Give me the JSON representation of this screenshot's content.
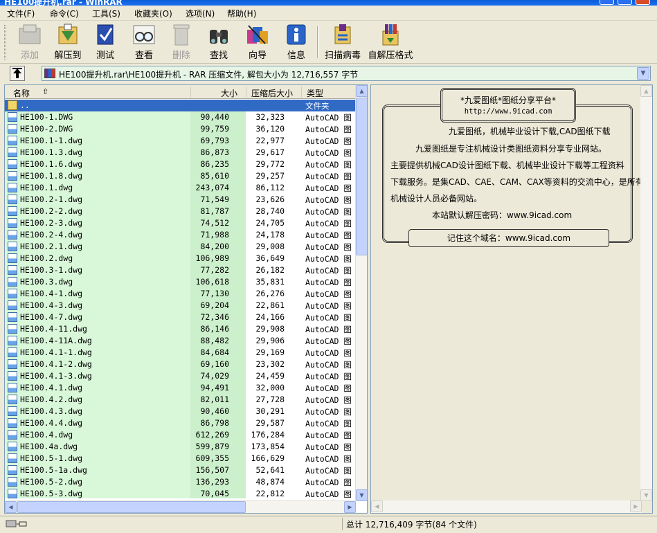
{
  "window": {
    "title": "HE100提升机.rar - WinRAR"
  },
  "menu": [
    "文件(F)",
    "命令(C)",
    "工具(S)",
    "收藏夹(O)",
    "选项(N)",
    "帮助(H)"
  ],
  "toolbar": [
    {
      "label": "添加",
      "icon": "add-archive-icon",
      "enabled": false
    },
    {
      "label": "解压到",
      "icon": "extract-to-icon",
      "enabled": true
    },
    {
      "label": "测试",
      "icon": "test-icon",
      "enabled": true
    },
    {
      "label": "查看",
      "icon": "view-glasses-icon",
      "enabled": true
    },
    {
      "label": "删除",
      "icon": "delete-icon",
      "enabled": false
    },
    {
      "label": "查找",
      "icon": "binoculars-icon",
      "enabled": true
    },
    {
      "label": "向导",
      "icon": "wizard-icon",
      "enabled": true
    },
    {
      "label": "信息",
      "icon": "info-icon",
      "enabled": true
    },
    {
      "label": "扫描病毒",
      "icon": "virus-scan-icon",
      "enabled": true
    },
    {
      "label": "自解压格式",
      "icon": "sfx-icon",
      "enabled": true
    }
  ],
  "address": {
    "text": "HE100提升机.rar\\HE100提升机 - RAR 压缩文件, 解包大小为 12,716,557 字节"
  },
  "columns": {
    "name": "名称",
    "size": "大小",
    "packed": "压缩后大小",
    "type": "类型"
  },
  "files": [
    {
      "name": "..",
      "size": "",
      "packed": "",
      "type": "文件夹",
      "folder": true
    },
    {
      "name": "HE100-1.DWG",
      "size": "90,440",
      "packed": "32,323",
      "type": "AutoCAD 图"
    },
    {
      "name": "HE100-2.DWG",
      "size": "99,759",
      "packed": "36,120",
      "type": "AutoCAD 图"
    },
    {
      "name": "HE100.1-1.dwg",
      "size": "69,793",
      "packed": "22,977",
      "type": "AutoCAD 图"
    },
    {
      "name": "HE100.1.3.dwg",
      "size": "86,873",
      "packed": "29,617",
      "type": "AutoCAD 图"
    },
    {
      "name": "HE100.1.6.dwg",
      "size": "86,235",
      "packed": "29,772",
      "type": "AutoCAD 图"
    },
    {
      "name": "HE100.1.8.dwg",
      "size": "85,610",
      "packed": "29,257",
      "type": "AutoCAD 图"
    },
    {
      "name": "HE100.1.dwg",
      "size": "243,074",
      "packed": "86,112",
      "type": "AutoCAD 图"
    },
    {
      "name": "HE100.2-1.dwg",
      "size": "71,549",
      "packed": "23,626",
      "type": "AutoCAD 图"
    },
    {
      "name": "HE100.2-2.dwg",
      "size": "81,787",
      "packed": "28,740",
      "type": "AutoCAD 图"
    },
    {
      "name": "HE100.2-3.dwg",
      "size": "74,512",
      "packed": "24,705",
      "type": "AutoCAD 图"
    },
    {
      "name": "HE100.2-4.dwg",
      "size": "71,988",
      "packed": "24,178",
      "type": "AutoCAD 图"
    },
    {
      "name": "HE100.2.1.dwg",
      "size": "84,200",
      "packed": "29,008",
      "type": "AutoCAD 图"
    },
    {
      "name": "HE100.2.dwg",
      "size": "106,989",
      "packed": "36,649",
      "type": "AutoCAD 图"
    },
    {
      "name": "HE100.3-1.dwg",
      "size": "77,282",
      "packed": "26,182",
      "type": "AutoCAD 图"
    },
    {
      "name": "HE100.3.dwg",
      "size": "106,618",
      "packed": "35,831",
      "type": "AutoCAD 图"
    },
    {
      "name": "HE100.4-1.dwg",
      "size": "77,130",
      "packed": "26,276",
      "type": "AutoCAD 图"
    },
    {
      "name": "HE100.4-3.dwg",
      "size": "69,204",
      "packed": "22,861",
      "type": "AutoCAD 图"
    },
    {
      "name": "HE100.4-7.dwg",
      "size": "72,346",
      "packed": "24,166",
      "type": "AutoCAD 图"
    },
    {
      "name": "HE100.4-11.dwg",
      "size": "86,146",
      "packed": "29,908",
      "type": "AutoCAD 图"
    },
    {
      "name": "HE100.4-11A.dwg",
      "size": "88,482",
      "packed": "29,906",
      "type": "AutoCAD 图"
    },
    {
      "name": "HE100.4.1-1.dwg",
      "size": "84,684",
      "packed": "29,169",
      "type": "AutoCAD 图"
    },
    {
      "name": "HE100.4.1-2.dwg",
      "size": "69,160",
      "packed": "23,302",
      "type": "AutoCAD 图"
    },
    {
      "name": "HE100.4.1-3.dwg",
      "size": "74,029",
      "packed": "24,459",
      "type": "AutoCAD 图"
    },
    {
      "name": "HE100.4.1.dwg",
      "size": "94,491",
      "packed": "32,000",
      "type": "AutoCAD 图"
    },
    {
      "name": "HE100.4.2.dwg",
      "size": "82,011",
      "packed": "27,728",
      "type": "AutoCAD 图"
    },
    {
      "name": "HE100.4.3.dwg",
      "size": "90,460",
      "packed": "30,291",
      "type": "AutoCAD 图"
    },
    {
      "name": "HE100.4.4.dwg",
      "size": "86,798",
      "packed": "29,587",
      "type": "AutoCAD 图"
    },
    {
      "name": "HE100.4.dwg",
      "size": "612,269",
      "packed": "176,284",
      "type": "AutoCAD 图"
    },
    {
      "name": "HE100.4a.dwg",
      "size": "599,879",
      "packed": "173,854",
      "type": "AutoCAD 图"
    },
    {
      "name": "HE100.5-1.dwg",
      "size": "609,355",
      "packed": "166,629",
      "type": "AutoCAD 图"
    },
    {
      "name": "HE100.5-1a.dwg",
      "size": "156,507",
      "packed": "52,641",
      "type": "AutoCAD 图"
    },
    {
      "name": "HE100.5-2.dwg",
      "size": "136,293",
      "packed": "48,874",
      "type": "AutoCAD 图"
    },
    {
      "name": "HE100.5-3.dwg",
      "size": "70,045",
      "packed": "22,812",
      "type": "AutoCAD 图"
    }
  ],
  "comment": {
    "title": "*九爱图纸*图纸分享平台*",
    "url": "http://www.9icad.com",
    "line1": "九爱图纸，机械毕业设计下载,CAD图纸下载",
    "line2": "九爱图纸是专注机械设计类图纸资料分享专业网站。",
    "line3": "主要提供机械CAD设计图纸下载、机械毕业设计下载等工程资料",
    "line4": "下载服务。是集CAD、CAE、CAM、CAX等资料的交流中心，是所有",
    "line5": "机械设计人员必备网站。",
    "line6": "本站默认解压密码：www.9icad.com",
    "footer": "记住这个域名：www.9icad.com"
  },
  "status": {
    "total": "总计 12,716,409 字节(84 个文件)"
  },
  "colors": {
    "selection": "#316ac5",
    "name_column": "#d9f7d9",
    "packed_column": "#ccefcc",
    "address_bg": "#e6f5e6"
  }
}
